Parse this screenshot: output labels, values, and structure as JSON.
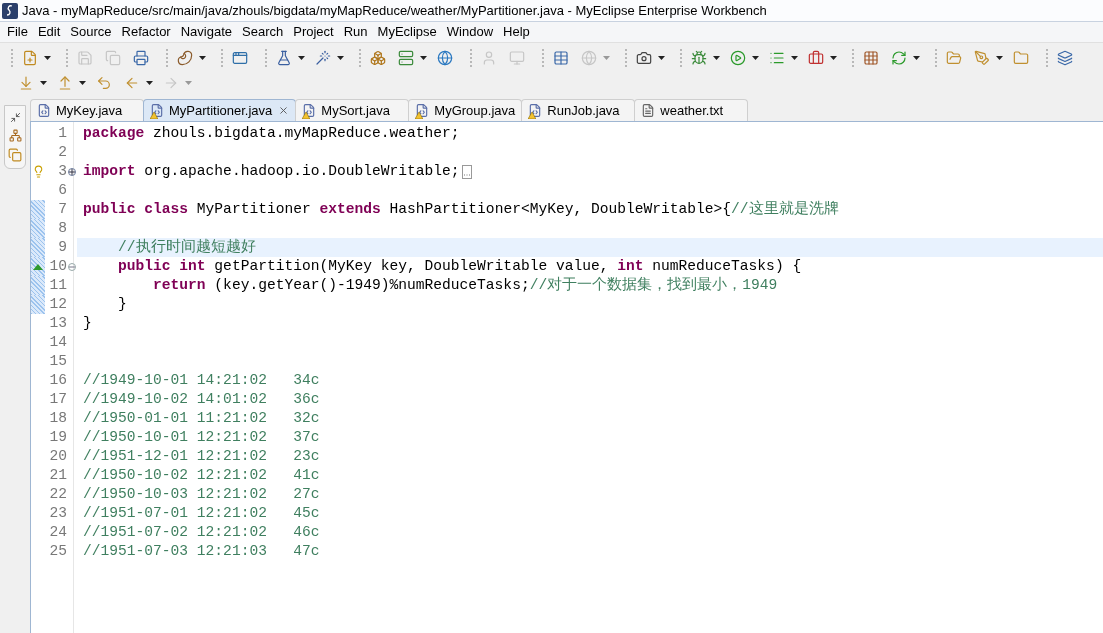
{
  "window": {
    "title": "Java - myMapReduce/src/main/java/zhouls/bigdata/myMapReduce/weather/MyPartitioner.java - MyEclipse Enterprise Workbench"
  },
  "menu": [
    "File",
    "Edit",
    "Source",
    "Refactor",
    "Navigate",
    "Search",
    "Project",
    "Run",
    "MyEclipse",
    "Window",
    "Help"
  ],
  "toolbar": [
    [
      [
        {
          "kind": "new",
          "disabled": false,
          "dropdown": true
        }
      ],
      [
        {
          "kind": "save",
          "disabled": true,
          "dropdown": false
        },
        {
          "kind": "save-all",
          "disabled": true,
          "dropdown": false
        },
        {
          "kind": "print",
          "disabled": false,
          "dropdown": false
        }
      ],
      [
        {
          "kind": "bean",
          "disabled": false,
          "dropdown": true
        }
      ],
      [
        {
          "kind": "app",
          "disabled": false,
          "dropdown": false
        }
      ],
      [
        {
          "kind": "wizard",
          "disabled": false,
          "dropdown": true
        },
        {
          "kind": "wand",
          "disabled": false,
          "dropdown": true
        }
      ],
      [
        {
          "kind": "deploy",
          "disabled": false,
          "dropdown": false
        },
        {
          "kind": "server",
          "disabled": false,
          "dropdown": true
        },
        {
          "kind": "globe",
          "disabled": false,
          "dropdown": false
        }
      ],
      [
        {
          "kind": "person",
          "disabled": true,
          "dropdown": false
        },
        {
          "kind": "screen",
          "disabled": true,
          "dropdown": false
        }
      ],
      [
        {
          "kind": "report",
          "disabled": false,
          "dropdown": false
        },
        {
          "kind": "globe",
          "disabled": true,
          "dropdown": true
        }
      ],
      [
        {
          "kind": "camera",
          "disabled": false,
          "dropdown": true
        }
      ],
      [
        {
          "kind": "bug",
          "disabled": false,
          "dropdown": true
        },
        {
          "kind": "run",
          "disabled": false,
          "dropdown": true
        },
        {
          "kind": "run-list",
          "disabled": false,
          "dropdown": true
        },
        {
          "kind": "run-tool",
          "disabled": false,
          "dropdown": true
        }
      ],
      [
        {
          "kind": "grid",
          "disabled": false,
          "dropdown": false
        },
        {
          "kind": "refresh",
          "disabled": false,
          "dropdown": true
        }
      ],
      [
        {
          "kind": "folder-open",
          "disabled": false,
          "dropdown": false
        },
        {
          "kind": "pen",
          "disabled": false,
          "dropdown": true
        },
        {
          "kind": "folder",
          "disabled": false,
          "dropdown": false
        }
      ],
      [
        {
          "kind": "perspective",
          "disabled": false,
          "dropdown": false
        }
      ]
    ],
    [
      [
        {
          "kind": "next-annotation",
          "disabled": false,
          "dropdown": true
        },
        {
          "kind": "prev-annotation",
          "disabled": false,
          "dropdown": true
        },
        {
          "kind": "last-edit",
          "disabled": false,
          "dropdown": false
        },
        {
          "kind": "back",
          "disabled": false,
          "dropdown": true
        },
        {
          "kind": "forward",
          "disabled": true,
          "dropdown": true
        }
      ]
    ]
  ],
  "tabs": [
    {
      "label": "MyKey.java",
      "kind": "java",
      "warning": false,
      "selected": false
    },
    {
      "label": "MyPartitioner.java",
      "kind": "java",
      "warning": true,
      "selected": true
    },
    {
      "label": "MySort.java",
      "kind": "java",
      "warning": true,
      "selected": false
    },
    {
      "label": "MyGroup.java",
      "kind": "java",
      "warning": true,
      "selected": false
    },
    {
      "label": "RunJob.java",
      "kind": "java",
      "warning": true,
      "selected": false
    },
    {
      "label": "weather.txt",
      "kind": "text",
      "warning": false,
      "selected": false
    }
  ],
  "editor": {
    "lines": [
      {
        "number": "1",
        "warning": false,
        "override": false,
        "collapsed": false,
        "expanded": false,
        "current": false,
        "changed": false,
        "tokens": [
          {
            "kind": "keyword",
            "text": "package"
          },
          {
            "kind": "plain",
            "text": " zhouls.bigdata.myMapReduce.weather;"
          }
        ]
      },
      {
        "number": "2",
        "warning": false,
        "override": false,
        "collapsed": false,
        "expanded": false,
        "current": false,
        "changed": false
      },
      {
        "number": "3",
        "warning": true,
        "override": false,
        "collapsed": true,
        "expanded": false,
        "current": false,
        "changed": false,
        "tokens": [
          {
            "kind": "keyword",
            "text": "import"
          },
          {
            "kind": "plain",
            "text": " org.apache.hadoop.io.DoubleWritable;"
          }
        ]
      },
      {
        "number": "6",
        "warning": false,
        "override": false,
        "collapsed": false,
        "expanded": false,
        "current": false,
        "changed": false
      },
      {
        "number": "7",
        "warning": false,
        "override": false,
        "collapsed": false,
        "expanded": false,
        "current": false,
        "changed": true,
        "tokens": [
          {
            "kind": "keyword",
            "text": "public class"
          },
          {
            "kind": "plain",
            "text": " MyPartitioner "
          },
          {
            "kind": "keyword",
            "text": "extends"
          },
          {
            "kind": "plain",
            "text": " HashPartitioner<MyKey, DoubleWritable>{"
          },
          {
            "kind": "comment",
            "text": "//这里就是洗牌"
          }
        ]
      },
      {
        "number": "8",
        "warning": false,
        "override": false,
        "collapsed": false,
        "expanded": false,
        "current": false,
        "changed": true
      },
      {
        "number": "9",
        "warning": false,
        "override": false,
        "collapsed": false,
        "expanded": false,
        "current": true,
        "changed": true,
        "tokens": [
          {
            "kind": "comment",
            "text": "    //执行时间越短越好"
          }
        ]
      },
      {
        "number": "10",
        "warning": false,
        "override": true,
        "collapsed": false,
        "expanded": true,
        "current": false,
        "changed": true,
        "tokens": [
          {
            "kind": "keyword",
            "text": "    public int"
          },
          {
            "kind": "plain",
            "text": " getPartition(MyKey key, DoubleWritable value, "
          },
          {
            "kind": "keyword",
            "text": "int"
          },
          {
            "kind": "plain",
            "text": " numReduceTasks) {"
          }
        ]
      },
      {
        "number": "11",
        "warning": false,
        "override": false,
        "collapsed": false,
        "expanded": false,
        "current": false,
        "changed": true,
        "tokens": [
          {
            "kind": "keyword",
            "text": "        return"
          },
          {
            "kind": "plain",
            "text": " (key.getYear()-1949)%numReduceTasks;"
          },
          {
            "kind": "comment",
            "text": "//对于一个数据集，找到最小，1949"
          }
        ]
      },
      {
        "number": "12",
        "warning": false,
        "override": false,
        "collapsed": false,
        "expanded": false,
        "current": false,
        "changed": true,
        "tokens": [
          {
            "kind": "plain",
            "text": "    }"
          }
        ]
      },
      {
        "number": "13",
        "warning": false,
        "override": false,
        "collapsed": false,
        "expanded": false,
        "current": false,
        "changed": false,
        "tokens": [
          {
            "kind": "plain",
            "text": "}"
          }
        ]
      },
      {
        "number": "14",
        "warning": false,
        "override": false,
        "collapsed": false,
        "expanded": false,
        "current": false,
        "changed": false
      },
      {
        "number": "15",
        "warning": false,
        "override": false,
        "collapsed": false,
        "expanded": false,
        "current": false,
        "changed": false
      },
      {
        "number": "16",
        "warning": false,
        "override": false,
        "collapsed": false,
        "expanded": false,
        "current": false,
        "changed": false,
        "tokens": [
          {
            "kind": "comment",
            "text": "//1949-10-01 14:21:02   34c"
          }
        ]
      },
      {
        "number": "17",
        "warning": false,
        "override": false,
        "collapsed": false,
        "expanded": false,
        "current": false,
        "changed": false,
        "tokens": [
          {
            "kind": "comment",
            "text": "//1949-10-02 14:01:02   36c"
          }
        ]
      },
      {
        "number": "18",
        "warning": false,
        "override": false,
        "collapsed": false,
        "expanded": false,
        "current": false,
        "changed": false,
        "tokens": [
          {
            "kind": "comment",
            "text": "//1950-01-01 11:21:02   32c"
          }
        ]
      },
      {
        "number": "19",
        "warning": false,
        "override": false,
        "collapsed": false,
        "expanded": false,
        "current": false,
        "changed": false,
        "tokens": [
          {
            "kind": "comment",
            "text": "//1950-10-01 12:21:02   37c"
          }
        ]
      },
      {
        "number": "20",
        "warning": false,
        "override": false,
        "collapsed": false,
        "expanded": false,
        "current": false,
        "changed": false,
        "tokens": [
          {
            "kind": "comment",
            "text": "//1951-12-01 12:21:02   23c"
          }
        ]
      },
      {
        "number": "21",
        "warning": false,
        "override": false,
        "collapsed": false,
        "expanded": false,
        "current": false,
        "changed": false,
        "tokens": [
          {
            "kind": "comment",
            "text": "//1950-10-02 12:21:02   41c"
          }
        ]
      },
      {
        "number": "22",
        "warning": false,
        "override": false,
        "collapsed": false,
        "expanded": false,
        "current": false,
        "changed": false,
        "tokens": [
          {
            "kind": "comment",
            "text": "//1950-10-03 12:21:02   27c"
          }
        ]
      },
      {
        "number": "23",
        "warning": false,
        "override": false,
        "collapsed": false,
        "expanded": false,
        "current": false,
        "changed": false,
        "tokens": [
          {
            "kind": "comment",
            "text": "//1951-07-01 12:21:02   45c"
          }
        ]
      },
      {
        "number": "24",
        "warning": false,
        "override": false,
        "collapsed": false,
        "expanded": false,
        "current": false,
        "changed": false,
        "tokens": [
          {
            "kind": "comment",
            "text": "//1951-07-02 12:21:02   46c"
          }
        ]
      },
      {
        "number": "25",
        "warning": false,
        "override": false,
        "collapsed": false,
        "expanded": false,
        "current": false,
        "changed": false,
        "tokens": [
          {
            "kind": "comment",
            "text": "//1951-07-03 12:21:03   47c"
          }
        ]
      }
    ]
  }
}
